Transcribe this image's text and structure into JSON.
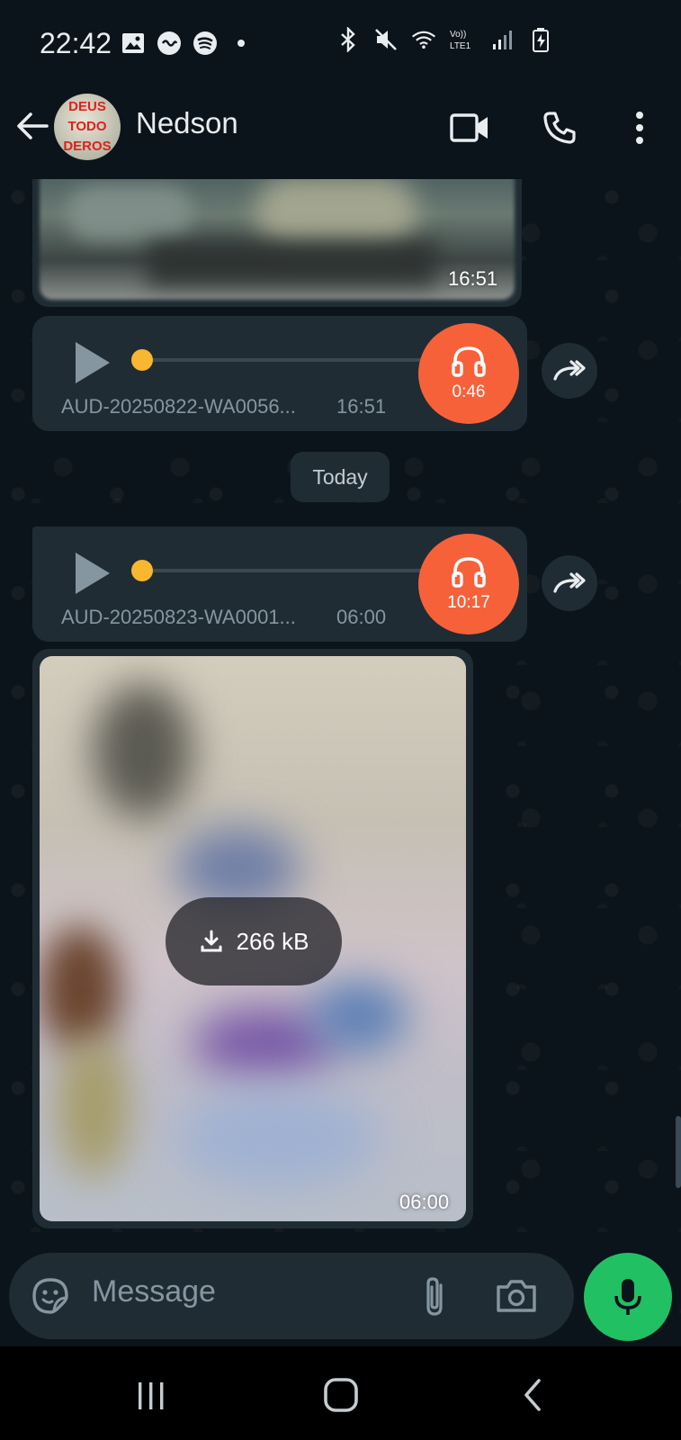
{
  "status_bar": {
    "time": "22:42",
    "left_icons": [
      "image-icon",
      "app-badge-icon",
      "spotify-icon",
      "dot-icon"
    ],
    "right_icons": [
      "bluetooth-icon",
      "mute-icon",
      "wifi-icon",
      "volte-icon",
      "signal-icon",
      "battery-icon"
    ],
    "volte_label": "Vo)) LTE1"
  },
  "header": {
    "contact_name": "Nedson",
    "avatar_text_lines": [
      "DEUS",
      "TODO",
      "DEROS"
    ],
    "actions": [
      "video-call-icon",
      "voice-call-icon",
      "more-options-icon"
    ]
  },
  "messages": {
    "image1": {
      "time": "16:51"
    },
    "audio1": {
      "filename": "AUD-20250822-WA0056...",
      "time": "16:51",
      "duration": "0:46",
      "progress": 0
    },
    "date_divider": "Today",
    "audio2": {
      "filename": "AUD-20250823-WA0001...",
      "time": "06:00",
      "duration": "10:17",
      "progress": 0
    },
    "image2": {
      "size": "266 kB",
      "time": "06:00"
    }
  },
  "composer": {
    "placeholder": "Message",
    "icons": [
      "sticker-icon",
      "attach-icon",
      "camera-icon",
      "mic-icon"
    ]
  },
  "colors": {
    "background": "#0b141a",
    "bubble": "#1f2c34",
    "accent_orange": "#f7613a",
    "progress_dot": "#f7b731",
    "mic_green": "#21c063"
  }
}
